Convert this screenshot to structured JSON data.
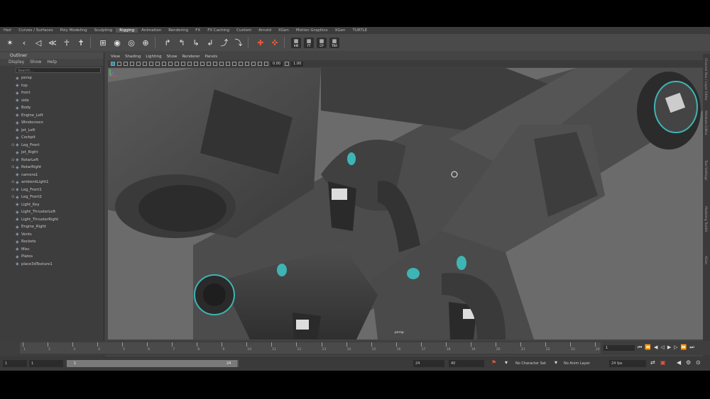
{
  "shelf_tabs": [
    {
      "label": "Hair",
      "active": false
    },
    {
      "label": "Curves / Surfaces",
      "active": false
    },
    {
      "label": "Poly Modeling",
      "active": false
    },
    {
      "label": "Sculpting",
      "active": false
    },
    {
      "label": "Rigging",
      "active": true
    },
    {
      "label": "Animation",
      "active": false
    },
    {
      "label": "Rendering",
      "active": false
    },
    {
      "label": "FX",
      "active": false
    },
    {
      "label": "FX Caching",
      "active": false
    },
    {
      "label": "Custom",
      "active": false
    },
    {
      "label": "Arnold",
      "active": false
    },
    {
      "label": "XGen",
      "active": false
    },
    {
      "label": "Motion Graphics",
      "active": false
    },
    {
      "label": "XGen",
      "active": false
    },
    {
      "label": "TURTLE",
      "active": false
    }
  ],
  "shelf_badges": [
    {
      "icon": "hik-icon",
      "label": "HIK"
    },
    {
      "icon": "ik-icon",
      "label": "FT"
    },
    {
      "icon": "cp-icon",
      "label": "CP"
    },
    {
      "icon": "tra-icon",
      "label": "TRA"
    }
  ],
  "outliner": {
    "title": "Outliner",
    "menus": [
      "Display",
      "Show",
      "Help"
    ],
    "search_placeholder": "Search...",
    "items": [
      {
        "label": "persp",
        "expandable": false
      },
      {
        "label": "top",
        "expandable": false
      },
      {
        "label": "front",
        "expandable": false
      },
      {
        "label": "side",
        "expandable": false
      },
      {
        "label": "Body",
        "expandable": false
      },
      {
        "label": "Engine_Left",
        "expandable": false
      },
      {
        "label": "Windscreen",
        "expandable": false
      },
      {
        "label": "Jet_Left",
        "expandable": false
      },
      {
        "label": "Cockpit",
        "expandable": false
      },
      {
        "label": "Leg_Front",
        "expandable": true
      },
      {
        "label": "Jet_Right",
        "expandable": false
      },
      {
        "label": "RotarLeft",
        "expandable": true
      },
      {
        "label": "RotarRight",
        "expandable": true
      },
      {
        "label": "camera1",
        "expandable": false
      },
      {
        "label": "ambientLight1",
        "expandable": true
      },
      {
        "label": "Leg_Front1",
        "expandable": true
      },
      {
        "label": "Leg_Front2",
        "expandable": true
      },
      {
        "label": "Light_Key",
        "expandable": false
      },
      {
        "label": "Light_ThrusterLeft",
        "expandable": false
      },
      {
        "label": "Light_ThrusterRight",
        "expandable": false
      },
      {
        "label": "Engine_Right",
        "expandable": false
      },
      {
        "label": "Vents",
        "expandable": false
      },
      {
        "label": "Rockets",
        "expandable": false
      },
      {
        "label": "Misc",
        "expandable": false
      },
      {
        "label": "Plates",
        "expandable": false
      },
      {
        "label": "place3dTexture1",
        "expandable": false
      }
    ]
  },
  "viewport": {
    "menus": [
      "View",
      "Shading",
      "Lighting",
      "Show",
      "Renderer",
      "Panels"
    ],
    "field_a": "0.00",
    "field_b": "1.00",
    "camera_label": "persp"
  },
  "right_panel_tabs": [
    "Channel Box / Layer Editor",
    "Attribute Editor",
    "Tool Settings",
    "Modeling Toolkit",
    "XGen"
  ],
  "timeline": {
    "ticks": [
      "1",
      "2",
      "3",
      "4",
      "5",
      "6",
      "7",
      "8",
      "9",
      "10",
      "11",
      "12",
      "13",
      "14",
      "15",
      "16",
      "17",
      "18",
      "19",
      "20",
      "21",
      "22",
      "23",
      "24"
    ],
    "current_frame": "1"
  },
  "range": {
    "start_field": "1",
    "start_inner": "1",
    "slider_start": "1",
    "slider_end": "24",
    "end_inner": "24",
    "end_field": "40",
    "character_set": "No Character Set",
    "anim_layer": "No Anim Layer",
    "fps": "24 fps"
  }
}
